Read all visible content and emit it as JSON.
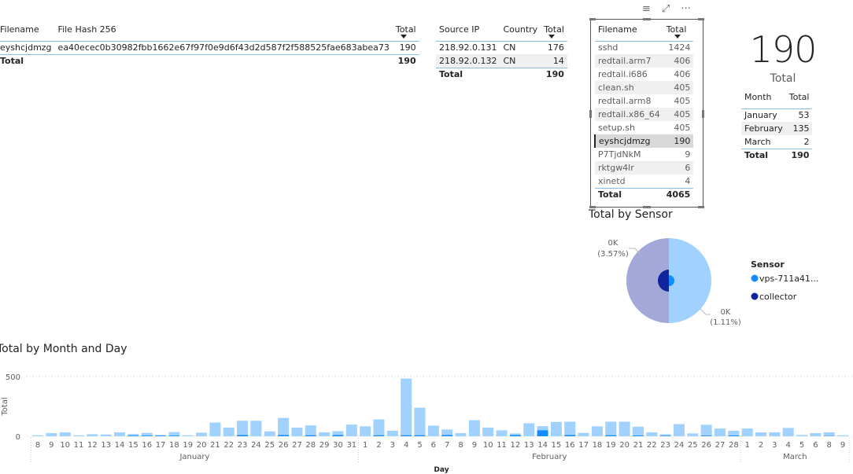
{
  "hash_table": {
    "headers": [
      "Filename",
      "File Hash 256",
      "Total"
    ],
    "rows": [
      [
        "eyshcjdmzg",
        "ea40ecec0b30982fbb1662e67f97f0e9d6f43d2d587f2f588525fae683abea73",
        "190"
      ]
    ],
    "total_label": "Total",
    "total": "190"
  },
  "ip_table": {
    "headers": [
      "Source IP",
      "Country",
      "Total"
    ],
    "rows": [
      [
        "218.92.0.131",
        "CN",
        "176"
      ],
      [
        "218.92.0.132",
        "CN",
        "14"
      ]
    ],
    "total_label": "Total",
    "total": "190"
  },
  "file_table": {
    "headers": [
      "Filename",
      "Total"
    ],
    "rows": [
      [
        "sshd",
        "1424"
      ],
      [
        "redtail.arm7",
        "406"
      ],
      [
        "redtail.i686",
        "406"
      ],
      [
        "clean.sh",
        "405"
      ],
      [
        "redtail.arm8",
        "405"
      ],
      [
        "redtail.x86_64",
        "405"
      ],
      [
        "setup.sh",
        "405"
      ],
      [
        "eyshcjdmzg",
        "190"
      ],
      [
        "P7TjdNkM",
        "9"
      ],
      [
        "rktgw4lr",
        "6"
      ],
      [
        "xinetd",
        "4"
      ]
    ],
    "selected": "eyshcjdmzg",
    "total_label": "Total",
    "total": "4065",
    "toolbar_icons": [
      "filter-icon",
      "focus-mode-icon",
      "more-options-icon"
    ]
  },
  "card": {
    "value": "190",
    "label": "Total"
  },
  "month_table": {
    "headers": [
      "Month",
      "Total"
    ],
    "rows": [
      [
        "January",
        "53"
      ],
      [
        "February",
        "135"
      ],
      [
        "March",
        "2"
      ]
    ],
    "total_label": "Total",
    "total": "190"
  },
  "chart_data": [
    {
      "type": "pie",
      "title": "Total by Sensor",
      "legend_title": "Sensor",
      "legend_placement": "right",
      "slices": [
        {
          "name": "vps-711a41...",
          "color": "#118DFF",
          "label": "0K",
          "pct_label": "(1.11%)"
        },
        {
          "name": "collector",
          "color": "#12239E",
          "label": "0K",
          "pct_label": "(3.57%)"
        }
      ]
    },
    {
      "type": "bar",
      "title": "Total by Month and Day",
      "xlabel": "Day",
      "ylabel": "Total",
      "ylim": [
        0,
        500
      ],
      "yticks": [
        "0",
        "500"
      ],
      "grid": true,
      "colors": {
        "base": "#A0D1FF",
        "highlight": "#118DFF"
      },
      "months": [
        {
          "name": "January",
          "days": [
            "8",
            "9",
            "10",
            "11",
            "12",
            "13",
            "14",
            "15",
            "16",
            "17",
            "18",
            "19",
            "20",
            "21",
            "22",
            "23",
            "24",
            "25",
            "26",
            "27",
            "28",
            "29",
            "30",
            "31"
          ],
          "values": [
            8,
            26,
            33,
            8,
            17,
            15,
            33,
            20,
            28,
            11,
            35,
            8,
            30,
            115,
            72,
            130,
            130,
            41,
            154,
            72,
            91,
            33,
            43,
            98
          ],
          "highlight": [
            0,
            0,
            0,
            0,
            0,
            0,
            0,
            5,
            5,
            5,
            5,
            0,
            0,
            0,
            0,
            10,
            0,
            0,
            10,
            0,
            8,
            0,
            10,
            0
          ]
        },
        {
          "name": "February",
          "days": [
            "1",
            "2",
            "3",
            "4",
            "5",
            "6",
            "7",
            "8",
            "9",
            "10",
            "11",
            "12",
            "13",
            "14",
            "15",
            "16",
            "17",
            "18",
            "19",
            "20",
            "21",
            "22",
            "23",
            "24",
            "25",
            "26",
            "27",
            "28"
          ],
          "values": [
            83,
            141,
            46,
            483,
            239,
            89,
            57,
            26,
            135,
            72,
            50,
            24,
            109,
            85,
            120,
            122,
            28,
            83,
            122,
            122,
            80,
            33,
            17,
            102,
            24,
            96,
            65,
            46
          ],
          "highlight": [
            0,
            8,
            0,
            8,
            8,
            0,
            10,
            0,
            0,
            0,
            0,
            10,
            0,
            50,
            0,
            10,
            0,
            0,
            8,
            0,
            6,
            0,
            4,
            0,
            0,
            5,
            0,
            6
          ]
        },
        {
          "name": "March",
          "days": [
            "1",
            "2",
            "3",
            "4",
            "5",
            "6",
            "8",
            "9"
          ],
          "values": [
            65,
            33,
            33,
            70,
            11,
            26,
            33,
            8
          ],
          "highlight": [
            0,
            0,
            0,
            0,
            0,
            0,
            2,
            0
          ]
        }
      ]
    }
  ]
}
